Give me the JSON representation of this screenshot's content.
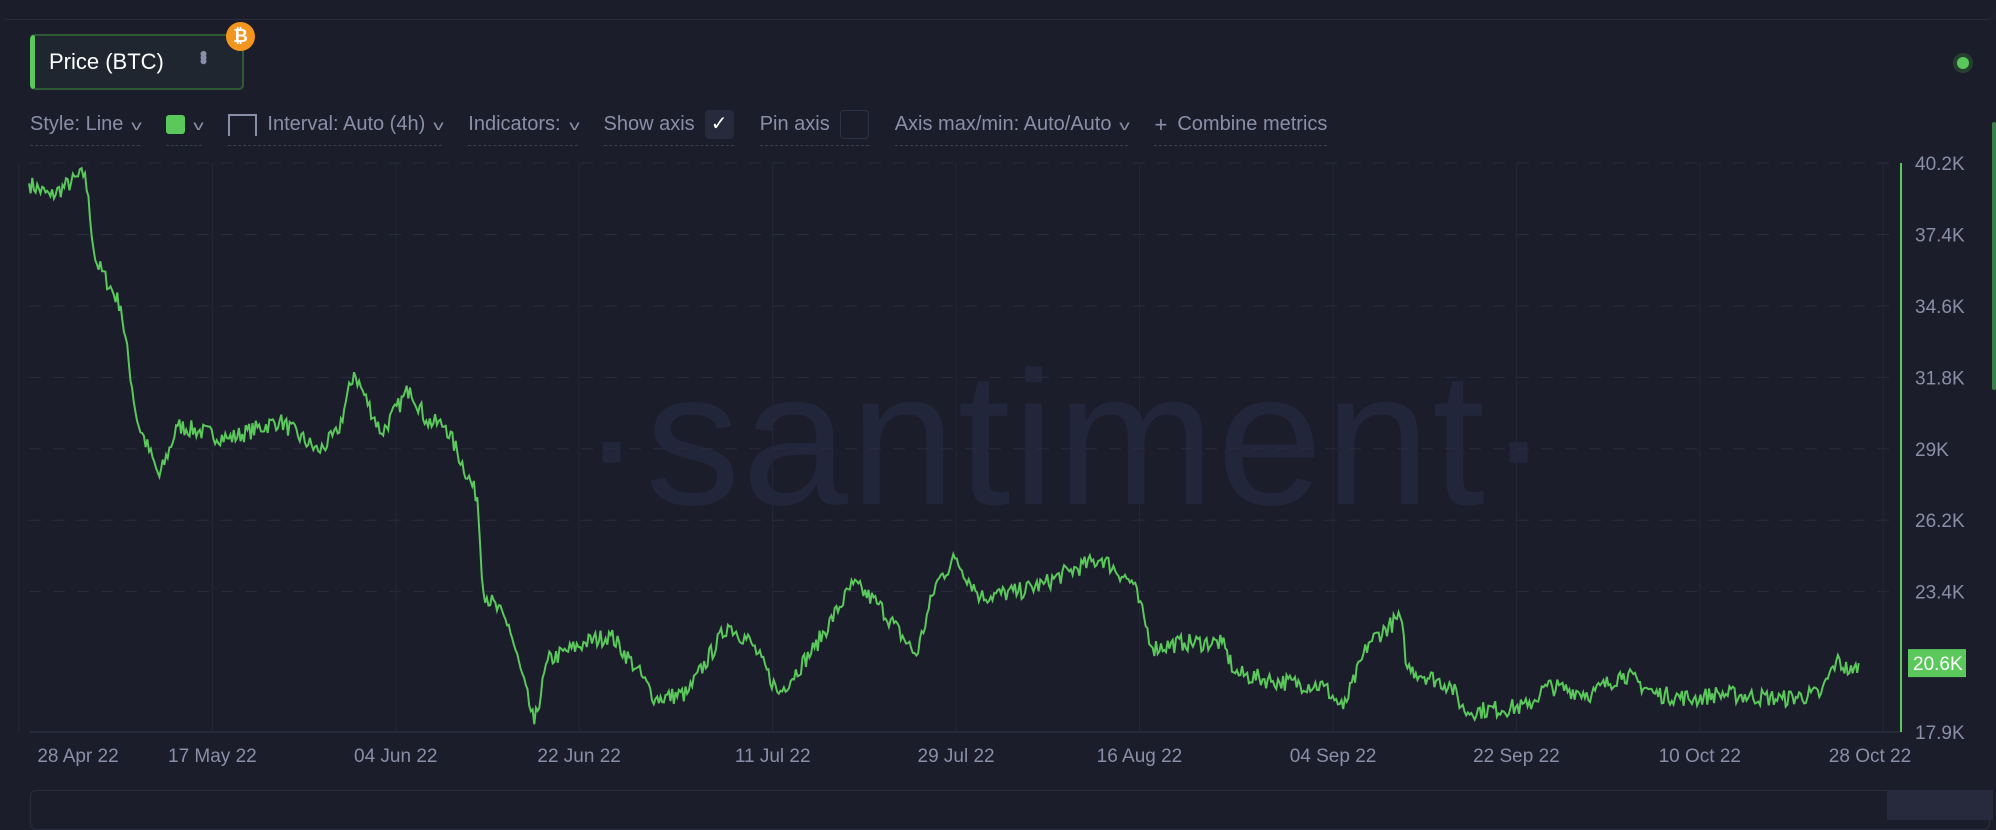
{
  "metric": {
    "label": "Price (BTC)",
    "asset_icon": "bitcoin-icon",
    "menu_icon": "more-vertical-icon"
  },
  "status": {
    "color": "#5ac85a"
  },
  "watermark": "·santiment·",
  "toolbar": {
    "style": "Style: Line",
    "color": "#5ac85a",
    "interval": "Interval: Auto (4h)",
    "indicators": "Indicators:",
    "show_axis": "Show axis",
    "show_axis_checked": true,
    "pin_axis": "Pin axis",
    "pin_axis_checked": false,
    "axis_maxmin": "Axis max/min: Auto/Auto",
    "combine": "Combine metrics",
    "check_glyph": "✓",
    "plus_glyph": "+"
  },
  "chart_data": {
    "type": "line",
    "title": "Price (BTC)",
    "xlabel": "",
    "ylabel": "",
    "x_units": "days since 28 Apr 22",
    "xlim": [
      1,
      184.75
    ],
    "ylim": [
      17.9,
      40.2
    ],
    "y_ticks": [
      "40.2K",
      "37.4K",
      "34.6K",
      "31.8K",
      "29K",
      "26.2K",
      "23.4K",
      "17.9K"
    ],
    "y_tick_values": [
      40.2,
      37.4,
      34.6,
      31.8,
      29.0,
      26.2,
      23.4,
      17.9
    ],
    "x_ticks": [
      "28 Apr 22",
      "17 May 22",
      "04 Jun 22",
      "22 Jun 22",
      "11 Jul 22",
      "29 Jul 22",
      "16 Aug 22",
      "04 Sep 22",
      "22 Sep 22",
      "10 Oct 22",
      "28 Oct 22"
    ],
    "x_tick_values": [
      0,
      19,
      37,
      55,
      74,
      92,
      110,
      129,
      147,
      165,
      183
    ],
    "current_value": "20.6K",
    "current_value_num": 20.6,
    "grid": true,
    "series": [
      {
        "name": "Price (BTC)",
        "color": "#5ac85a",
        "x": [
          1,
          3.1,
          6.5,
          7.5,
          10,
          11.6,
          13.8,
          15.6,
          20.6,
          25.6,
          29.4,
          31.3,
          32.9,
          35.6,
          38.4,
          40,
          41.9,
          45,
          45.6,
          48.1,
          50.6,
          51.9,
          55.6,
          58.1,
          60.6,
          62.5,
          65.6,
          69.6,
          71.9,
          74.6,
          78.1,
          81.9,
          84.4,
          88.1,
          90,
          91.9,
          94.4,
          98.1,
          100.6,
          103.1,
          106.3,
          109.4,
          111.3,
          114.4,
          118.1,
          119.4,
          123.1,
          128.1,
          130,
          132.5,
          135.6,
          136.3,
          140.6,
          141.9,
          148.1,
          150,
          154.4,
          157.5,
          160.6,
          164.4,
          166.9,
          173.1,
          176.9,
          178.4,
          180,
          180.6
        ],
        "values": [
          39.4,
          38.9,
          39.8,
          36.4,
          34.6,
          30.1,
          27.9,
          29.9,
          29.4,
          30.1,
          28.9,
          29.6,
          32.0,
          29.6,
          31.4,
          30.1,
          29.9,
          27.1,
          23.4,
          22.1,
          18.2,
          20.7,
          21.4,
          21.7,
          20.4,
          19.2,
          19.4,
          22.1,
          21.4,
          19.4,
          21.2,
          23.7,
          22.9,
          20.9,
          23.7,
          24.7,
          23.2,
          23.4,
          23.7,
          24.2,
          24.7,
          23.7,
          21.2,
          21.4,
          21.4,
          20.2,
          19.9,
          19.7,
          18.8,
          21.4,
          22.4,
          20.4,
          19.7,
          18.7,
          18.9,
          19.7,
          19.4,
          20.2,
          19.4,
          19.2,
          19.4,
          19.2,
          19.4,
          20.7,
          20.2,
          20.6
        ]
      }
    ]
  }
}
